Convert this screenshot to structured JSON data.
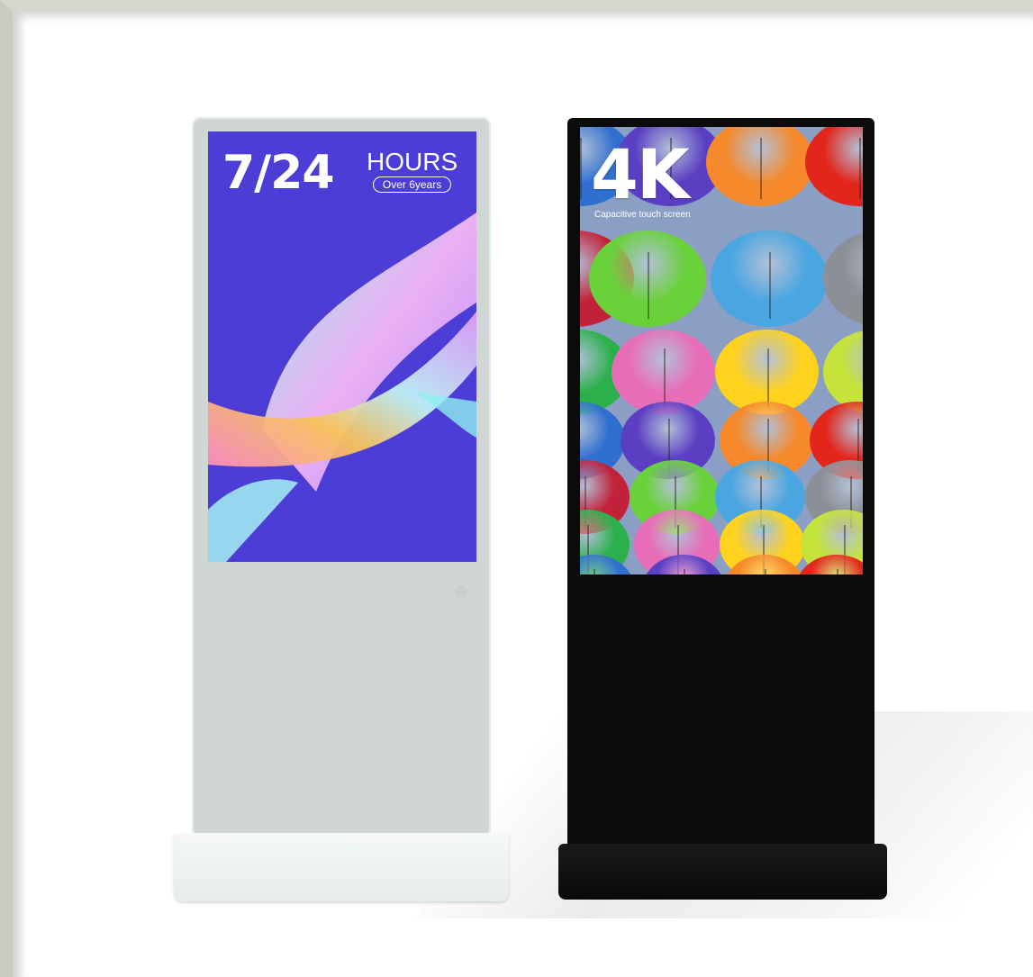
{
  "product_white": {
    "headline": "7/24",
    "hours_label": "HOURS",
    "hours_sub": "Over 6years",
    "screen_color": "#4c3dd6",
    "body_color": "#cfd6d4"
  },
  "product_black": {
    "headline": "4K",
    "caption": "Capacitive touch screen",
    "body_color": "#0b0b0b"
  },
  "umbrella_colors": [
    "#e86db9",
    "#f5892b",
    "#8c8f96",
    "#2f6fd0",
    "#69d13a",
    "#ffd21e",
    "#e3261c",
    "#2bb04c",
    "#5a3fc2",
    "#4aa6e0",
    "#c5e33a",
    "#c2213a"
  ]
}
